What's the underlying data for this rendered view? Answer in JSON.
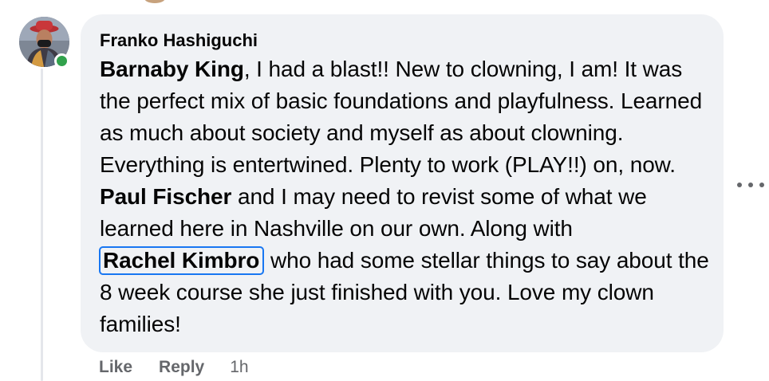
{
  "comment": {
    "author": "Franko Hashiguchi",
    "text_segments": {
      "mention_1": "Barnaby King",
      "text_1": ", I had a blast!! New to clowning, I am! It was the perfect mix of basic foundations and playfulness. Learned as much about society and myself as about clowning. Everything is entertwined. Plenty to work (PLAY!!) on, now. ",
      "mention_2": "Paul Fischer",
      "text_2": " and I may need to revist some of what we learned here in Nashville on our own. Along with ",
      "mention_3": "Rachel Kimbro",
      "text_3": "  who had some stellar things to say about the 8 week course she just finished with you. Love my clown families!"
    },
    "status": "online"
  },
  "actions": {
    "like": "Like",
    "reply": "Reply",
    "time": "1h"
  },
  "icons": {
    "avatar": "profile-photo",
    "online": "online-status-dot",
    "more": "more-options-icon"
  },
  "colors": {
    "bubble": "#f0f2f5",
    "text": "#050505",
    "secondary": "#65676b",
    "online": "#31a24c",
    "focus": "#1877f2"
  }
}
